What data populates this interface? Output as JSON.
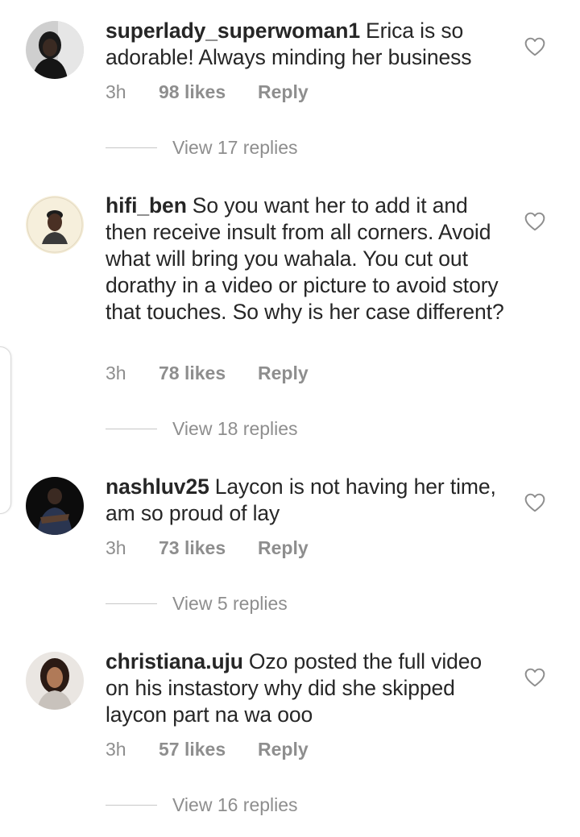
{
  "comments": [
    {
      "username": "superlady_superwoman1",
      "text": "Erica is so adorable!  Always minding her business",
      "time": "3h",
      "likes": "98 likes",
      "reply": "Reply",
      "view_replies": "View 17 replies"
    },
    {
      "username": "hifi_ben",
      "text": "So you want her to add it and then receive insult from all corners. Avoid what will bring you wahala. You cut out dorathy in a video or picture to avoid story that touches. So why is her case different?",
      "time": "3h",
      "likes": "78 likes",
      "reply": "Reply",
      "view_replies": "View 18 replies"
    },
    {
      "username": "nashluv25",
      "text": "Laycon is not having her time, am so proud of lay",
      "time": "3h",
      "likes": "73 likes",
      "reply": "Reply",
      "view_replies": "View 5 replies"
    },
    {
      "username": "christiana.uju",
      "text": "Ozo posted the full video on his instastory why did she skipped laycon part na wa ooo",
      "time": "3h",
      "likes": "57 likes",
      "reply": "Reply",
      "view_replies": "View 16 replies"
    }
  ],
  "colors": {
    "text": "#262626",
    "meta": "#8e8e8e",
    "divider": "#c7c7c7"
  },
  "icons": {
    "like": "heart-outline-icon",
    "avatar": "user-avatar-photo"
  }
}
